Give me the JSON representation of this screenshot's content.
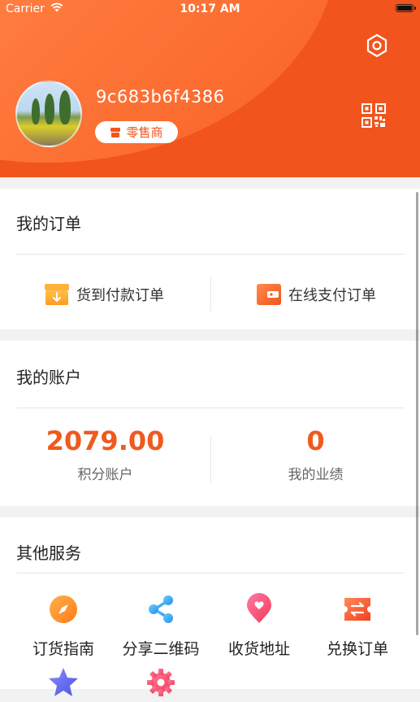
{
  "status_bar": {
    "carrier": "Carrier",
    "time": "10:17 AM"
  },
  "profile": {
    "username": "9c683b6f4386",
    "badge": "零售商"
  },
  "orders": {
    "title": "我的订单",
    "cash_on_delivery": "货到付款订单",
    "online_payment": "在线支付订单"
  },
  "account": {
    "title": "我的账户",
    "points_value": "2079.00",
    "points_label": "积分账户",
    "performance_value": "0",
    "performance_label": "我的业绩"
  },
  "services": {
    "title": "其他服务",
    "items": [
      {
        "label": "订货指南",
        "icon": "compass-icon"
      },
      {
        "label": "分享二维码",
        "icon": "share-icon"
      },
      {
        "label": "收货地址",
        "icon": "location-pin-icon"
      },
      {
        "label": "兑换订单",
        "icon": "exchange-ticket-icon"
      },
      {
        "label": "",
        "icon": "star-icon"
      },
      {
        "label": "",
        "icon": "settings-gear-icon"
      }
    ]
  },
  "colors": {
    "accent": "#f2541d",
    "accent_light": "#ff9a59",
    "value_orange": "#ef5a1e"
  }
}
